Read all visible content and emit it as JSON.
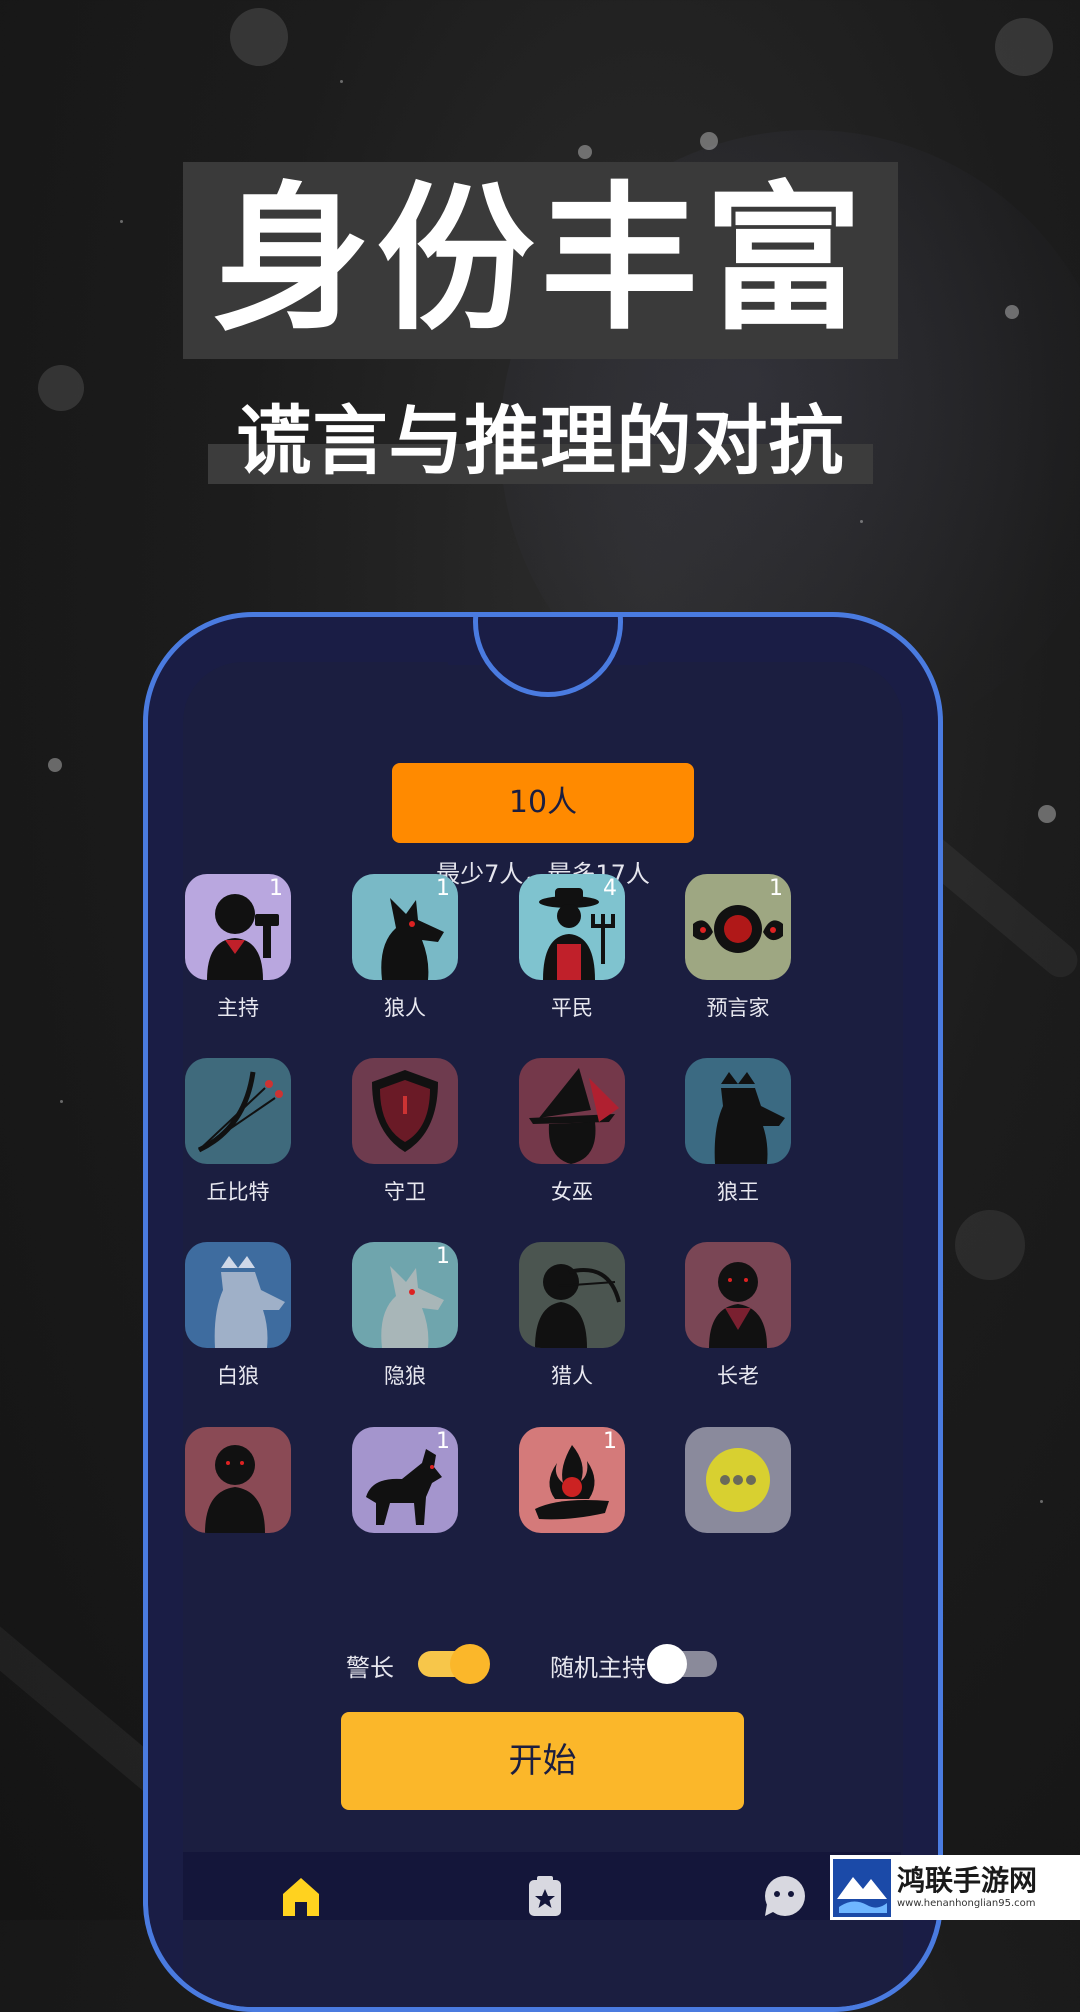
{
  "headline": "身份丰富",
  "subheadline": "谎言与推理的对抗",
  "player_count_button": "10人",
  "player_range": "最少7人，最多17人",
  "roles": [
    {
      "name": "主持",
      "count": "1",
      "bg": "#b9a7df"
    },
    {
      "name": "狼人",
      "count": "1",
      "bg": "#79b9c6"
    },
    {
      "name": "平民",
      "count": "4",
      "bg": "#7fc3cf"
    },
    {
      "name": "预言家",
      "count": "1",
      "bg": "#9ea782"
    },
    {
      "name": "丘比特",
      "count": "",
      "bg": "#3f6a7c"
    },
    {
      "name": "守卫",
      "count": "",
      "bg": "#6e3b4e"
    },
    {
      "name": "女巫",
      "count": "",
      "bg": "#74384a"
    },
    {
      "name": "狼王",
      "count": "",
      "bg": "#3b6a82"
    },
    {
      "name": "白狼",
      "count": "",
      "bg": "#3e6c9f"
    },
    {
      "name": "隐狼",
      "count": "1",
      "bg": "#6fa5ad"
    },
    {
      "name": "猎人",
      "count": "",
      "bg": "#4b5550"
    },
    {
      "name": "长老",
      "count": "",
      "bg": "#7a4655"
    },
    {
      "name": "",
      "count": "",
      "bg": "#8a4a55"
    },
    {
      "name": "",
      "count": "1",
      "bg": "#a495cd"
    },
    {
      "name": "",
      "count": "1",
      "bg": "#d47a7a"
    },
    {
      "name": "",
      "count": "",
      "bg": "#8a8a9c"
    }
  ],
  "toggles": {
    "sheriff_label": "警长",
    "sheriff_on": true,
    "random_host_label": "随机主持",
    "random_host_on": false
  },
  "start_button": "开始",
  "tabs": [
    "home-icon",
    "cards-icon",
    "chat-icon"
  ],
  "watermark": {
    "title": "鸿联手游网",
    "url": "www.henanhonglian95.com"
  },
  "colors": {
    "accent_orange": "#ff8a00",
    "accent_yellow": "#fbb72a",
    "phone_frame": "#4a7be0",
    "screen_bg": "#1b1e40"
  }
}
